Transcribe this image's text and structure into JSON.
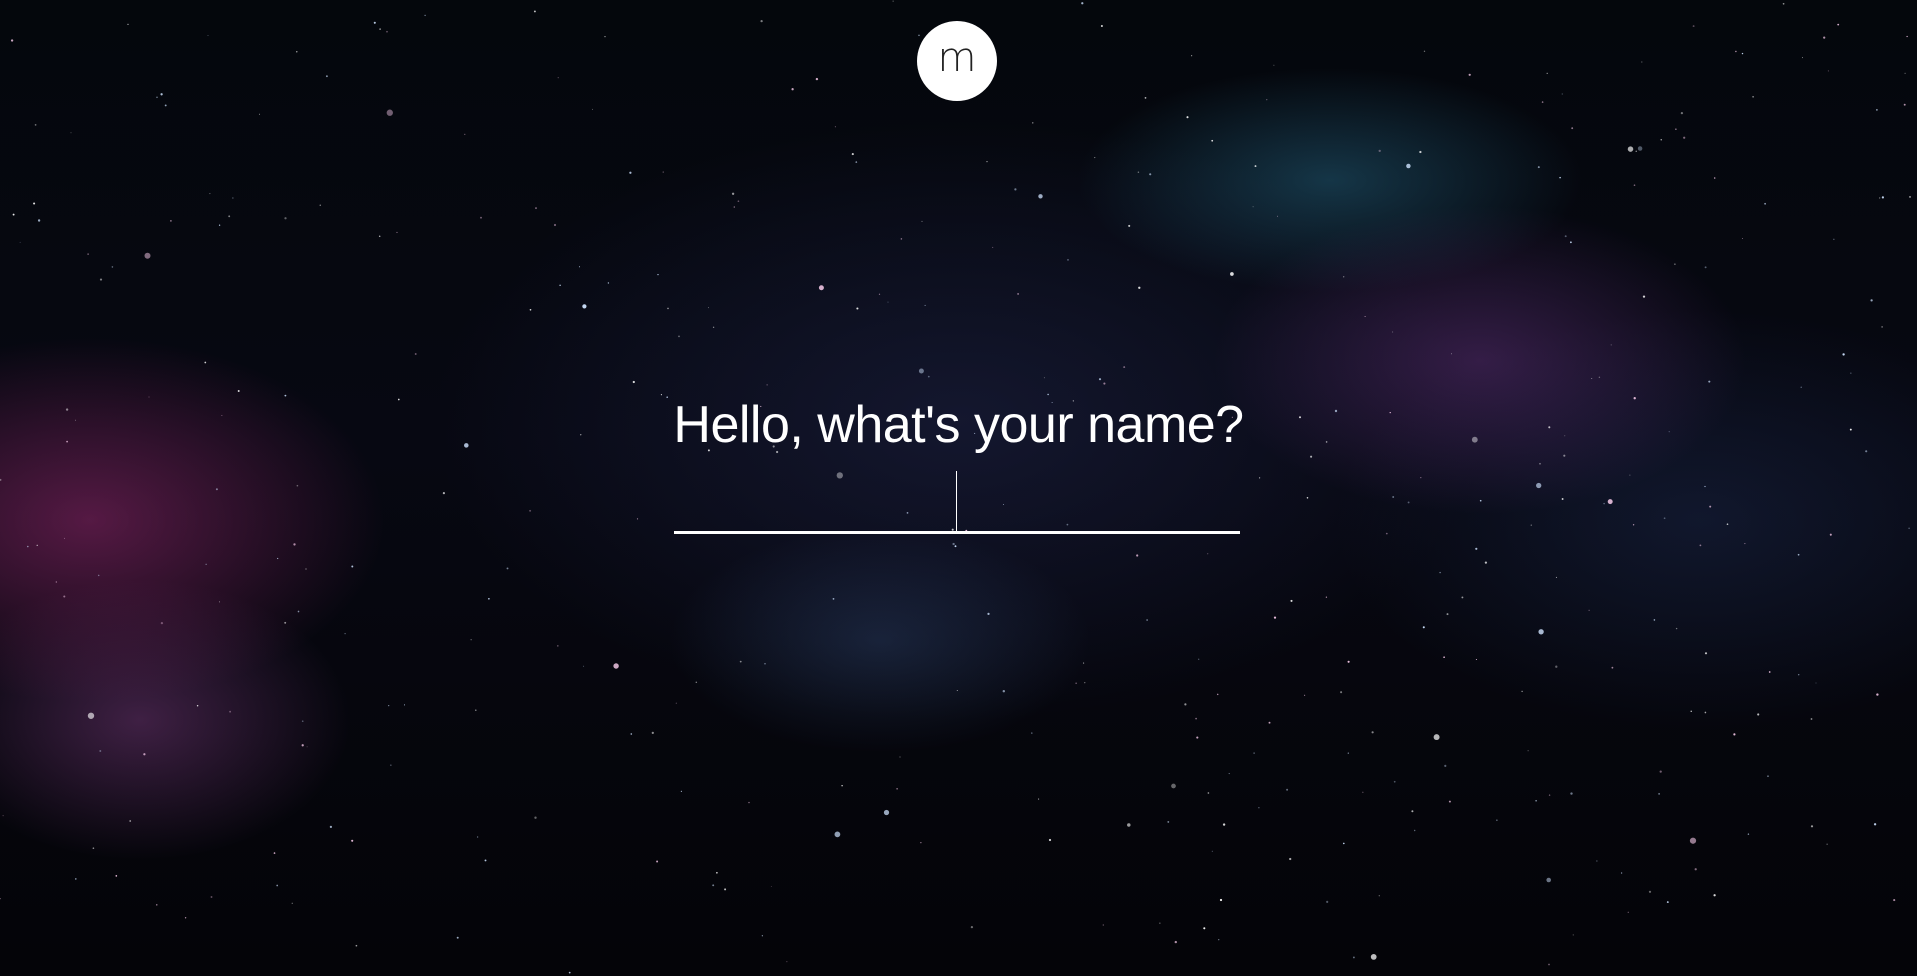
{
  "logo": {
    "letter": "m"
  },
  "prompt": {
    "question": "Hello, what's your name?"
  },
  "name_input": {
    "value": "",
    "placeholder": ""
  },
  "colors": {
    "text": "#ffffff",
    "logo_bg": "#ffffff",
    "logo_text": "#222222",
    "background": "#05060b"
  }
}
